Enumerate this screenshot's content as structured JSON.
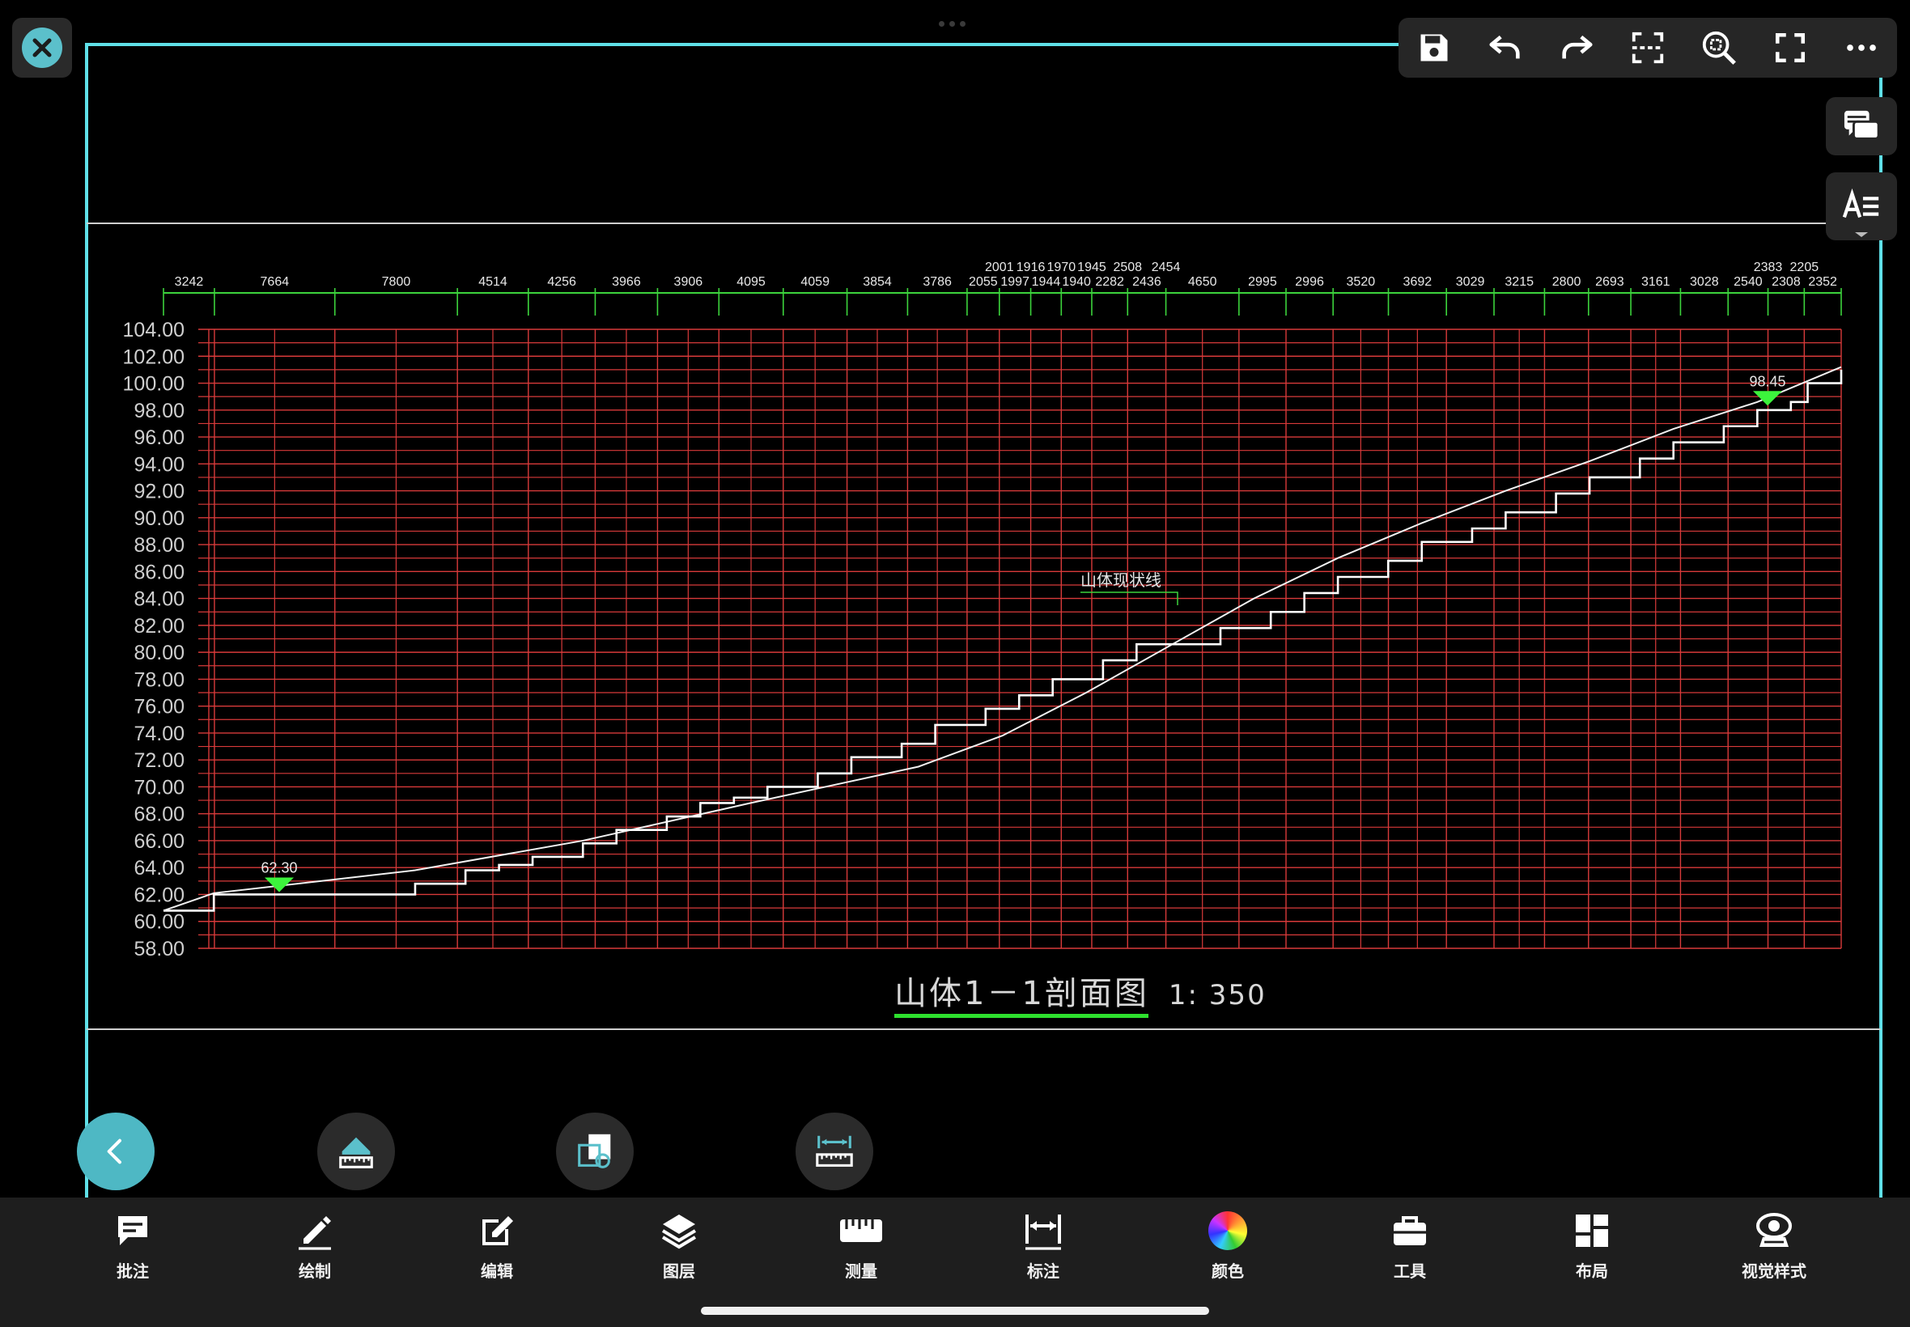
{
  "colors": {
    "accent": "#5bc0cb",
    "frame": "#5fe0e8",
    "grid": "#d83a3a",
    "dim_line": "#3cd33c",
    "marker": "#3cf33c"
  },
  "top_toolbar": {
    "icons": [
      "save-icon",
      "undo-icon",
      "redo-icon",
      "scan-icon",
      "zoom-extents-icon",
      "fullscreen-icon",
      "more-icon"
    ]
  },
  "side_buttons": {
    "icons": [
      "comment-list-icon",
      "text-style-icon"
    ]
  },
  "drawing": {
    "title": "山体1－1剖面图",
    "scale": "1: 350",
    "annotation": "山体现状线",
    "left_marker": "62.30",
    "right_marker": "98.45"
  },
  "chart_data": {
    "type": "line",
    "title": "山体1－1剖面图",
    "ylim": [
      58,
      104
    ],
    "yticks": [
      "104.00",
      "102.00",
      "100.00",
      "98.00",
      "96.00",
      "94.00",
      "92.00",
      "90.00",
      "88.00",
      "86.00",
      "84.00",
      "82.00",
      "80.00",
      "78.00",
      "76.00",
      "74.00",
      "72.00",
      "70.00",
      "68.00",
      "66.00",
      "64.00",
      "62.00",
      "60.00",
      "58.00"
    ],
    "grid": true,
    "dimension_row_low": [
      "3242",
      "7664",
      "7800",
      "4514",
      "4256",
      "3966",
      "3906",
      "4095",
      "4059",
      "3854",
      "3786",
      "2055",
      "1997",
      "1944",
      "1940",
      "2282",
      "2436",
      "4650",
      "2995",
      "2996",
      "3520",
      "3692",
      "3029",
      "3215",
      "2800",
      "2693",
      "3161",
      "3028",
      "2540",
      "2308",
      "2352"
    ],
    "dimension_row_high": [
      "2001",
      "1916",
      "1970",
      "1945",
      "2508",
      "2454",
      "2383",
      "2205"
    ],
    "series": [
      {
        "name": "山体现状线",
        "x": [
          0,
          0.03,
          0.08,
          0.15,
          0.25,
          0.35,
          0.45,
          0.5,
          0.55,
          0.6,
          0.65,
          0.7,
          0.75,
          0.8,
          0.85,
          0.9,
          0.95,
          1.0
        ],
        "values": [
          60.8,
          62.1,
          62.8,
          63.8,
          66.0,
          68.8,
          71.5,
          73.8,
          77.0,
          80.5,
          84.0,
          87.0,
          89.6,
          92.0,
          94.2,
          96.6,
          98.6,
          101.2
        ]
      },
      {
        "name": "",
        "x": [
          0,
          0.03,
          0.07,
          0.1,
          0.15,
          0.18,
          0.2,
          0.22,
          0.25,
          0.27,
          0.3,
          0.32,
          0.34,
          0.36,
          0.39,
          0.41,
          0.44,
          0.46,
          0.49,
          0.51,
          0.53,
          0.56,
          0.58,
          0.61,
          0.63,
          0.66,
          0.68,
          0.7,
          0.73,
          0.75,
          0.78,
          0.8,
          0.83,
          0.85,
          0.88,
          0.9,
          0.93,
          0.95,
          0.97,
          0.98,
          1.0
        ],
        "values": [
          60.8,
          62.0,
          62.0,
          62.0,
          62.8,
          63.8,
          64.2,
          64.8,
          65.8,
          66.8,
          67.8,
          68.8,
          69.2,
          70.0,
          71.0,
          72.2,
          73.2,
          74.6,
          75.8,
          76.8,
          78.0,
          79.4,
          80.6,
          80.6,
          81.8,
          83.0,
          84.4,
          85.6,
          86.8,
          88.2,
          89.2,
          90.4,
          91.8,
          93.0,
          94.4,
          95.6,
          96.8,
          98.0,
          98.6,
          100.0,
          101.0
        ]
      }
    ]
  },
  "fab_tools": {
    "icons": [
      "back-icon",
      "measure-area-icon",
      "measure-region-icon",
      "measure-distance-icon"
    ]
  },
  "bottom_tabs": [
    {
      "label": "批注",
      "icon": "annotation-icon"
    },
    {
      "label": "绘制",
      "icon": "pencil-icon"
    },
    {
      "label": "编辑",
      "icon": "edit-icon"
    },
    {
      "label": "图层",
      "icon": "layers-icon"
    },
    {
      "label": "测量",
      "icon": "ruler-icon"
    },
    {
      "label": "标注",
      "icon": "dimension-icon"
    },
    {
      "label": "颜色",
      "icon": "color-wheel-icon"
    },
    {
      "label": "工具",
      "icon": "toolbox-icon"
    },
    {
      "label": "布局",
      "icon": "layout-icon"
    },
    {
      "label": "视觉样式",
      "icon": "visual-style-icon"
    }
  ]
}
